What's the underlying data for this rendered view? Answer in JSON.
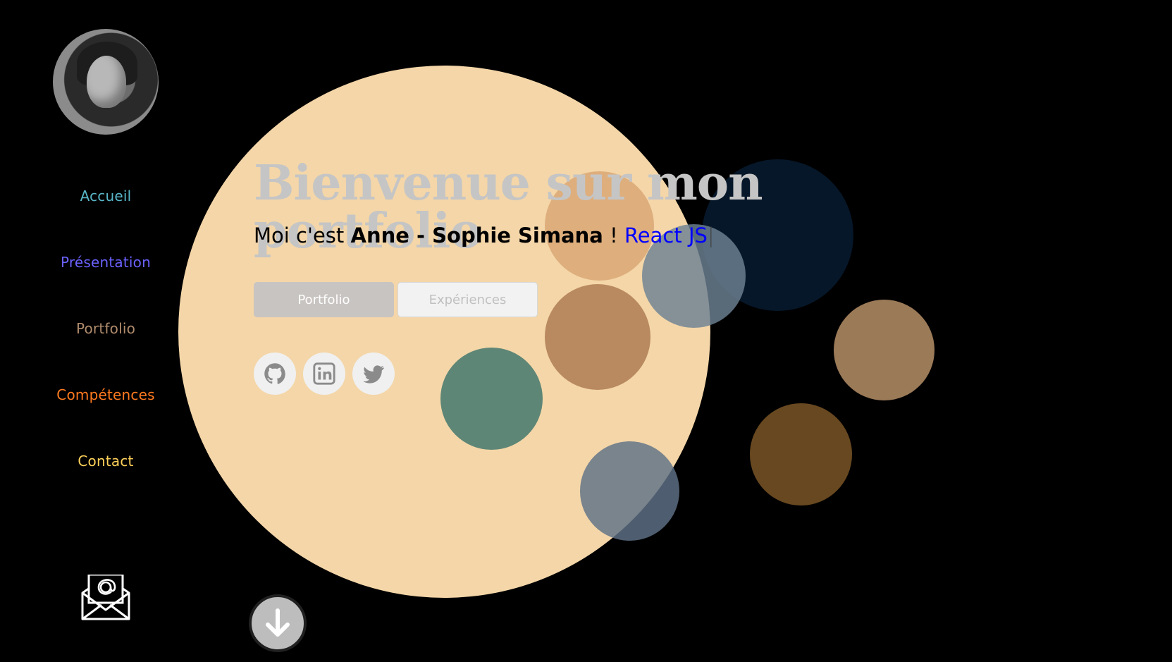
{
  "profile": {
    "avatar_alt": "Anne - Sophie Simana"
  },
  "nav": {
    "items": [
      {
        "label": "Accueil",
        "color": "#58b6c8"
      },
      {
        "label": "Présentation",
        "color": "#6b62ff"
      },
      {
        "label": "Portfolio",
        "color": "#b08c6d"
      },
      {
        "label": "Compétences",
        "color": "#ff7a1f"
      },
      {
        "label": "Contact",
        "color": "#ffd25a"
      }
    ]
  },
  "hero": {
    "title": "Bienvenue sur mon portfolio",
    "intro_prefix": "Moi c'est ",
    "name": "Anne - Sophie Simana",
    "exclamation": " ! ",
    "rotating_text": "React JS",
    "caret": "|"
  },
  "buttons": {
    "primary": "Portfolio",
    "secondary": "Expériences"
  },
  "socials": [
    {
      "icon": "github-icon"
    },
    {
      "icon": "linkedin-icon"
    },
    {
      "icon": "twitter-icon"
    }
  ],
  "icons": {
    "mail": "mail-at-icon",
    "scroll": "arrow-down-icon"
  },
  "colors": {
    "background": "#000000",
    "main_bubble": "#f4d6a8",
    "highlight": "#0000ff"
  }
}
